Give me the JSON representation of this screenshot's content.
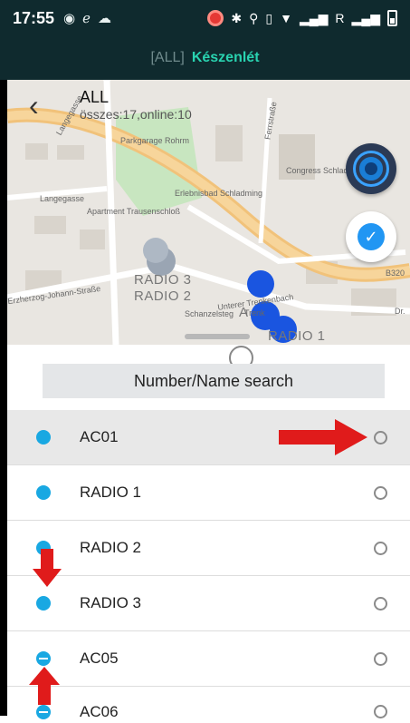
{
  "status_bar": {
    "time": "17:55",
    "signal_text": "R"
  },
  "header": {
    "group_label": "[ALL]",
    "mode_label": "Készenlét"
  },
  "map": {
    "title": "ALL",
    "subtitle": "összes:17,online:10",
    "street_labels": [
      "Langegasse",
      "Langegasse",
      "Erzherzog-Johann-Straße",
      "Unterer Trenkenbach",
      "Schanzelsteg",
      "Congress Schladming",
      "Erlebnisbad Schladming",
      "Parkgarage Rohrm",
      "Apartment Trausenschloß",
      "B320",
      "Dr.",
      "Trenk",
      "Ferrstraße"
    ],
    "marker_labels": [
      "RADIO 3",
      "RADIO 2",
      "A",
      "RADIO 1"
    ]
  },
  "search": {
    "placeholder": "Number/Name search"
  },
  "members": [
    {
      "name": "AC01",
      "status": "online",
      "selected": true
    },
    {
      "name": "RADIO 1",
      "status": "online",
      "selected": false
    },
    {
      "name": "RADIO 2",
      "status": "online",
      "selected": false
    },
    {
      "name": "RADIO 3",
      "status": "online",
      "selected": false
    },
    {
      "name": "AC05",
      "status": "busy",
      "selected": false
    },
    {
      "name": "AC06",
      "status": "busy",
      "selected": false
    }
  ],
  "colors": {
    "header_bg": "#0f2a2e",
    "mode_accent": "#29d3b0",
    "online_dot": "#19a8e2",
    "annotation_arrow": "#e01b1b"
  }
}
